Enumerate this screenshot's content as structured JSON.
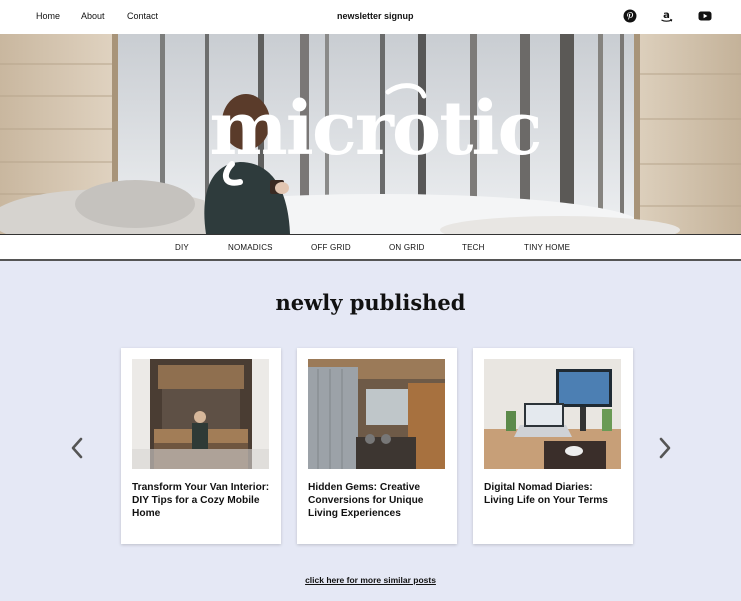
{
  "header": {
    "nav": [
      "Home",
      "About",
      "Contact"
    ],
    "signup_label": "newsletter signup",
    "social": [
      "pinterest-icon",
      "amazon-icon",
      "youtube-icon"
    ]
  },
  "hero": {
    "logo_text": "microtic"
  },
  "categories": [
    "DIY",
    "NOMADICS",
    "OFF GRID",
    "ON GRID",
    "TECH",
    "TINY HOME"
  ],
  "section": {
    "title": "newly published",
    "more_link": "click here for more similar posts"
  },
  "posts": [
    {
      "title": "Transform Your Van Interior: DIY Tips for a Cozy Mobile Home"
    },
    {
      "title": "Hidden Gems: Creative Conversions for Unique Living Experiences"
    },
    {
      "title": "Digital Nomad Diaries: Living Life on Your Terms"
    }
  ],
  "colors": {
    "section_bg": "#e5e8f5",
    "text": "#111111"
  }
}
